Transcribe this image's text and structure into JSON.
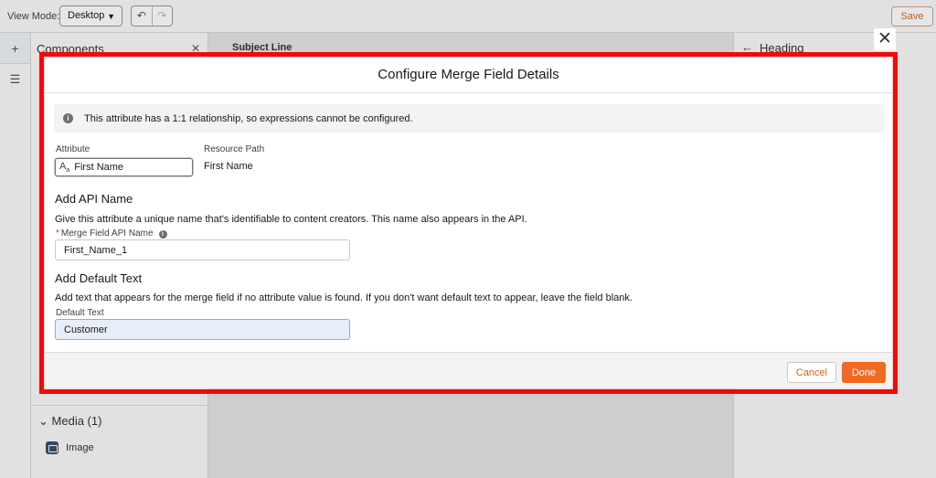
{
  "toolbar": {
    "view_mode_label": "View Mode:",
    "view_mode_value": "Desktop",
    "save_label": "Save"
  },
  "components_panel": {
    "title": "Components",
    "media_section": "Media (1)",
    "media_items": [
      "Image"
    ]
  },
  "canvas": {
    "subject_label": "Subject Line"
  },
  "properties_panel": {
    "title": "Heading"
  },
  "modal": {
    "title": "Configure Merge Field Details",
    "info_text": "This attribute has a 1:1 relationship, so expressions cannot be configured.",
    "attribute_label": "Attribute",
    "attribute_value": "First Name",
    "resource_path_label": "Resource Path",
    "resource_path_value": "First Name",
    "api_section_title": "Add API Name",
    "api_section_desc": "Give this attribute a unique name that's identifiable to content creators. This name also appears in the API.",
    "api_field_label": "Merge Field API Name",
    "api_field_value": "First_Name_1",
    "default_section_title": "Add Default Text",
    "default_section_desc": "Add text that appears for the merge field if no attribute value is found. If you don't want default text to appear, leave the field blank.",
    "default_field_label": "Default Text",
    "default_field_value": "Customer",
    "cancel_label": "Cancel",
    "done_label": "Done"
  },
  "colors": {
    "highlight": "#f20a0a",
    "primary_button": "#f26a21",
    "required_asterisk": "#c23934"
  }
}
